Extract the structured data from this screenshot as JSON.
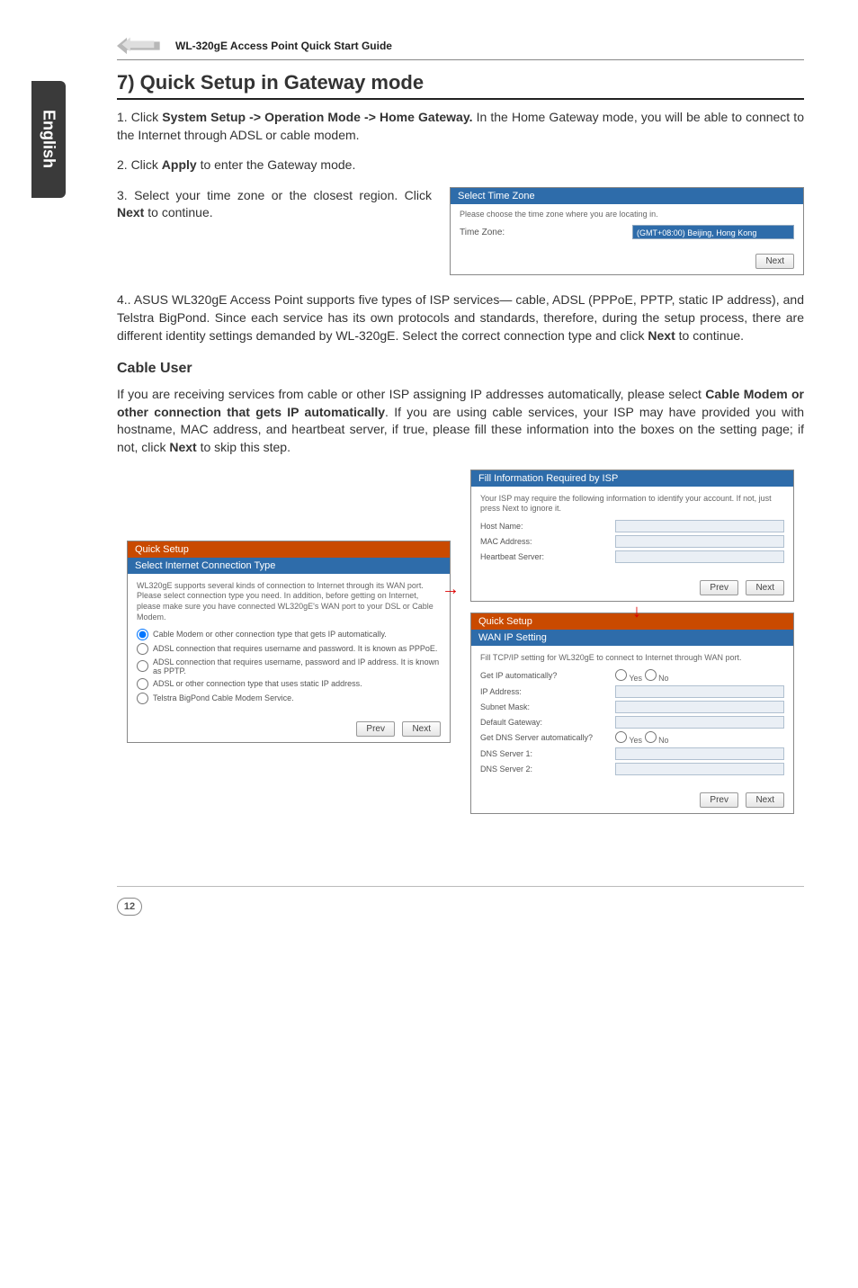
{
  "header": {
    "guide_title": "WL-320gE Access Point Quick Start Guide"
  },
  "side_tab": {
    "label": "English"
  },
  "section": {
    "heading": "7) Quick Setup in Gateway mode",
    "p1_prefix": "1. Click ",
    "p1_bold": "System Setup -> Operation Mode -> Home Gateway.",
    "p1_suffix": " In the Home Gateway mode, you will be able to connect to the Internet through ADSL or cable modem.",
    "p2_prefix": "2. Click ",
    "p2_bold": "Apply",
    "p2_suffix": " to enter the Gateway mode.",
    "p3_prefix": "3. Select your time zone or the closest region. Click ",
    "p3_bold": "Next",
    "p3_suffix": " to continue.",
    "p4_pre": "4.. ASUS WL320gE Access Point supports five types of ISP services— cable, ADSL (PPPoE, PPTP, static IP address), and Telstra BigPond. Since each service has its own protocols and standards, therefore, during the setup process, there are different identity settings demanded by WL-320gE. Select the correct connection type and click ",
    "p4_bold": "Next",
    "p4_suf": " to continue."
  },
  "tz_panel": {
    "header": "Select Time Zone",
    "note": "Please choose the time zone where you are locating in.",
    "label": "Time Zone:",
    "value": "(GMT+08:00) Beijing, Hong Kong",
    "btn": "Next"
  },
  "cable": {
    "heading": "Cable User",
    "para_pre": "If you are receiving services from cable or other ISP assigning IP addresses automatically, please select ",
    "para_bold1": "Cable Modem or other connection that gets IP automatically",
    "para_mid": ". If you are using cable services, your ISP may have provided you with hostname, MAC address, and heartbeat server, if true, please fill these information into the boxes on the setting page; if not, click ",
    "para_bold2": "Next",
    "para_suf": " to skip this step."
  },
  "quick_setup": {
    "header": "Quick Setup",
    "subheader": "Select Internet Connection Type",
    "note": "WL320gE supports several kinds of connection to Internet through its WAN port. Please select connection type you need. In addition, before getting on Internet, please make sure you have connected WL320gE's WAN port to your DSL or Cable Modem.",
    "opt1": "Cable Modem or other connection type that gets IP automatically.",
    "opt2": "ADSL connection that requires username and password. It is known as PPPoE.",
    "opt3": "ADSL connection that requires username, password and IP address. It is known as PPTP.",
    "opt4": "ADSL or other connection type that uses static IP address.",
    "opt5": "Telstra BigPond Cable Modem Service.",
    "btn_prev": "Prev",
    "btn_next": "Next"
  },
  "fill_info": {
    "header": "Fill Information Required by ISP",
    "note": "Your ISP may require the following information to identify your account. If not, just press Next to ignore it.",
    "f1": "Host Name:",
    "f2": "MAC Address:",
    "f3": "Heartbeat Server:",
    "btn_prev": "Prev",
    "btn_next": "Next"
  },
  "wan_ip": {
    "header1": "Quick Setup",
    "header2": "WAN IP Setting",
    "note": "Fill TCP/IP setting for WL320gE to connect to Internet through WAN port.",
    "q1": "Get IP automatically?",
    "yes": "Yes",
    "no": "No",
    "f1": "IP Address:",
    "f2": "Subnet Mask:",
    "f3": "Default Gateway:",
    "q2": "Get DNS Server automatically?",
    "f4": "DNS Server 1:",
    "f5": "DNS Server 2:",
    "btn_prev": "Prev",
    "btn_next": "Next"
  },
  "footer": {
    "page": "12"
  }
}
